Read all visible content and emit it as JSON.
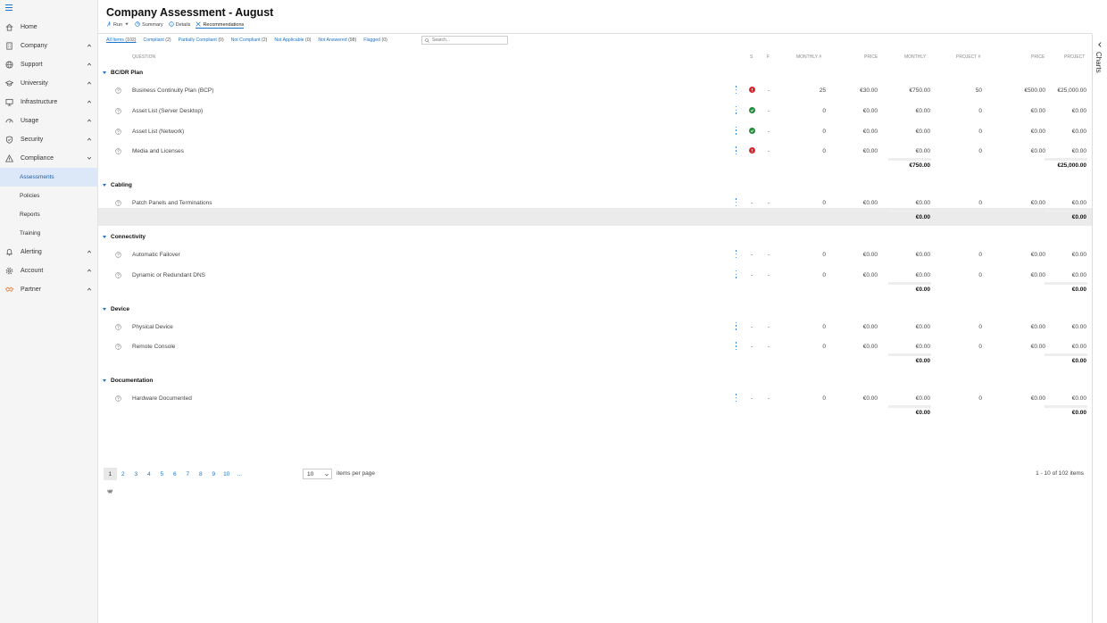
{
  "nav": [
    {
      "label": "Home",
      "icon": "home-icon",
      "chevron": ""
    },
    {
      "label": "Company",
      "icon": "building-icon",
      "chevron": "up"
    },
    {
      "label": "Support",
      "icon": "globe-icon",
      "chevron": "up"
    },
    {
      "label": "University",
      "icon": "graduation-cap-icon",
      "chevron": "up"
    },
    {
      "label": "Infrastructure",
      "icon": "monitor-icon",
      "chevron": "up"
    },
    {
      "label": "Usage",
      "icon": "gauge-icon",
      "chevron": "up"
    },
    {
      "label": "Security",
      "icon": "shield-icon",
      "chevron": "up"
    },
    {
      "label": "Compliance",
      "icon": "warning-triangle-icon",
      "chevron": "down"
    }
  ],
  "compliance_sub": [
    {
      "label": "Assessments",
      "active": true
    },
    {
      "label": "Policies",
      "active": false
    },
    {
      "label": "Reports",
      "active": false
    },
    {
      "label": "Training",
      "active": false
    }
  ],
  "nav_after": [
    {
      "label": "Alerting",
      "icon": "bell-icon",
      "chevron": "up"
    },
    {
      "label": "Account",
      "icon": "gear-icon",
      "chevron": "up"
    },
    {
      "label": "Partner",
      "icon": "handshake-icon",
      "chevron": "up",
      "color": "#e8772e"
    }
  ],
  "page": {
    "title": "Company Assessment - August"
  },
  "tabs": [
    {
      "label": "Run",
      "icon": "run-icon",
      "has_caret": true
    },
    {
      "label": "Summary",
      "icon": "summary-icon"
    },
    {
      "label": "Details",
      "icon": "details-icon"
    },
    {
      "label": "Recommendations",
      "icon": "recommendations-icon",
      "active": true
    }
  ],
  "filters": [
    {
      "label": "All Items",
      "count": "(102)",
      "active": true
    },
    {
      "label": "Compliant",
      "count": "(2)"
    },
    {
      "label": "Partially Compliant",
      "count": "(0)"
    },
    {
      "label": "Not Compliant",
      "count": "(2)"
    },
    {
      "label": "Not Applicable",
      "count": "(0)"
    },
    {
      "label": "Not Answered",
      "count": "(98)"
    },
    {
      "label": "Flagged",
      "count": "(0)"
    }
  ],
  "search": {
    "placeholder": "Search..."
  },
  "columns": {
    "question": "Question",
    "s": "S",
    "f": "F",
    "monthly_qty": "Monthly #",
    "monthly_price": "Price",
    "monthly": "Monthly",
    "project_qty": "Project #",
    "project_price": "Price",
    "project": "Project"
  },
  "groups": [
    {
      "name": "BC/DR Plan",
      "rows": [
        {
          "q": "Business Continuity Plan (BCP)",
          "status": "red",
          "f": "-",
          "mq": "25",
          "mp": "€30.00",
          "m": "€750.00",
          "pq": "50",
          "pp": "€500.00",
          "p": "€25,000.00"
        },
        {
          "q": "Asset List (Server Desktop)",
          "status": "green",
          "f": "-",
          "mq": "0",
          "mp": "€0.00",
          "m": "€0.00",
          "pq": "0",
          "pp": "€0.00",
          "p": "€0.00"
        },
        {
          "q": "Asset List (Network)",
          "status": "green",
          "f": "-",
          "mq": "0",
          "mp": "€0.00",
          "m": "€0.00",
          "pq": "0",
          "pp": "€0.00",
          "p": "€0.00"
        },
        {
          "q": "Media and Licenses",
          "status": "red",
          "f": "-",
          "mq": "0",
          "mp": "€0.00",
          "m": "€0.00",
          "pq": "0",
          "pp": "€0.00",
          "p": "€0.00"
        }
      ],
      "total_m": "€750.00",
      "total_p": "€25,000.00"
    },
    {
      "name": "Cabling",
      "rows": [
        {
          "q": "Patch Panels and Terminations",
          "status": "-",
          "f": "-",
          "mq": "0",
          "mp": "€0.00",
          "m": "€0.00",
          "pq": "0",
          "pp": "€0.00",
          "p": "€0.00"
        }
      ],
      "total_m": "€0.00",
      "total_p": "€0.00"
    },
    {
      "name": "Connectivity",
      "rows": [
        {
          "q": "Automatic Failover",
          "status": "-",
          "f": "-",
          "mq": "0",
          "mp": "€0.00",
          "m": "€0.00",
          "pq": "0",
          "pp": "€0.00",
          "p": "€0.00"
        },
        {
          "q": "Dynamic or Redundant DNS",
          "status": "-",
          "f": "-",
          "mq": "0",
          "mp": "€0.00",
          "m": "€0.00",
          "pq": "0",
          "pp": "€0.00",
          "p": "€0.00"
        }
      ],
      "total_m": "€0.00",
      "total_p": "€0.00"
    },
    {
      "name": "Device",
      "rows": [
        {
          "q": "Physical Device",
          "status": "-",
          "f": "-",
          "mq": "0",
          "mp": "€0.00",
          "m": "€0.00",
          "pq": "0",
          "pp": "€0.00",
          "p": "€0.00"
        },
        {
          "q": "Remote Console",
          "status": "-",
          "f": "-",
          "mq": "0",
          "mp": "€0.00",
          "m": "€0.00",
          "pq": "0",
          "pp": "€0.00",
          "p": "€0.00"
        }
      ],
      "total_m": "€0.00",
      "total_p": "€0.00"
    },
    {
      "name": "Documentation",
      "rows": [
        {
          "q": "Hardware Documented",
          "status": "-",
          "f": "-",
          "mq": "0",
          "mp": "€0.00",
          "m": "€0.00",
          "pq": "0",
          "pp": "€0.00",
          "p": "€0.00"
        }
      ],
      "total_m": "€0.00",
      "total_p": "€0.00"
    }
  ],
  "pager": {
    "first": "⏮",
    "prev": "◂",
    "next": "▸",
    "last": "⏭",
    "pages": [
      "1",
      "2",
      "3",
      "4",
      "5",
      "6",
      "7",
      "8",
      "9",
      "10",
      "..."
    ],
    "current": "1",
    "per_page": "10",
    "per_page_label": "items per page",
    "range": "1 - 10 of 102 items"
  },
  "right_panel": {
    "label": "Charts"
  },
  "colors": {
    "accent": "#1a73c9",
    "red": "#d9262c",
    "green": "#238a3a",
    "partner": "#e8772e"
  }
}
